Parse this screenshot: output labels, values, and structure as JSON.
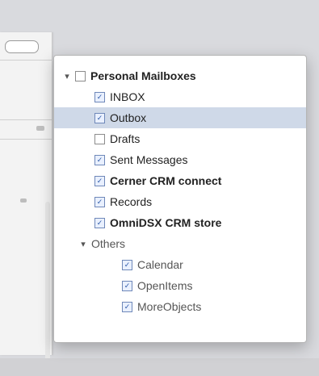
{
  "colors": {
    "selection": "#cfd9e8",
    "checkbox_check": "#2b58a5",
    "popup_bg": "#ffffff",
    "background": "#d9dade"
  },
  "tree": {
    "root": {
      "label": "Personal Mailboxes",
      "expanded": true,
      "children": [
        {
          "label": "INBOX",
          "checked": true
        },
        {
          "label": "Outbox",
          "checked": true,
          "selected": true
        },
        {
          "label": "Drafts",
          "checked": false
        },
        {
          "label": "Sent Messages",
          "checked": true
        },
        {
          "label": "Cerner CRM connect",
          "checked": true,
          "bold": true
        },
        {
          "label": "Records",
          "checked": true
        },
        {
          "label": "OmniDSX CRM store",
          "checked": true,
          "bold": true
        }
      ]
    },
    "others": {
      "label": "Others",
      "expanded": true,
      "children": [
        {
          "label": "Calendar",
          "checked": true
        },
        {
          "label": "OpenItems",
          "checked": true
        },
        {
          "label": "MoreObjects",
          "checked": true
        }
      ]
    }
  },
  "icons": {
    "disclosure_expanded": "▾",
    "checkmark": "✓"
  }
}
